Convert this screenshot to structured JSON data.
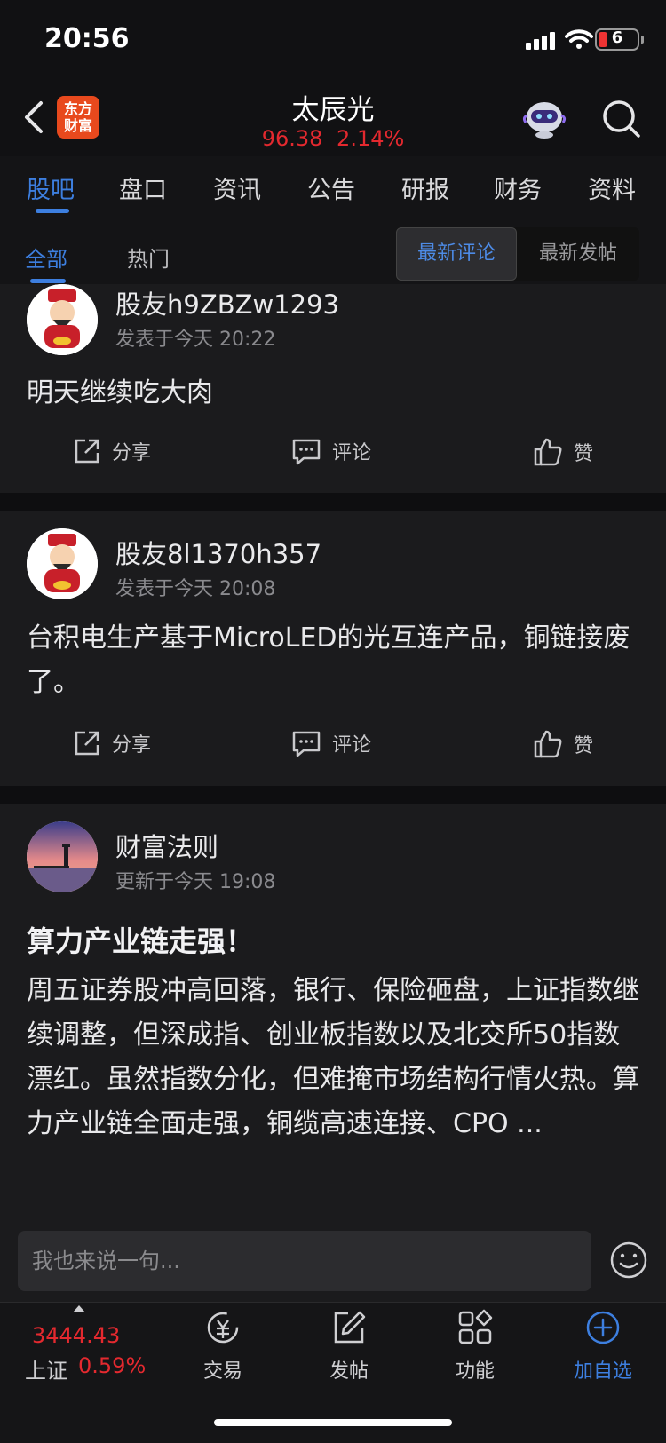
{
  "status": {
    "time": "20:56",
    "battery": "6"
  },
  "header": {
    "logo_line1": "东方",
    "logo_line2": "财富",
    "title": "太辰光",
    "price": "96.38",
    "change": "2.14%"
  },
  "tabs": [
    "股吧",
    "盘口",
    "资讯",
    "公告",
    "研报",
    "财务",
    "资料"
  ],
  "filter": {
    "all": "全部",
    "hot": "热门",
    "latest_comment": "最新评论",
    "latest_post": "最新发帖"
  },
  "actions": {
    "share": "分享",
    "comment": "评论",
    "like": "赞"
  },
  "posts": [
    {
      "user": "股友h9ZBZw1293",
      "time": "发表于今天 20:22",
      "text": "明天继续吃大肉"
    },
    {
      "user": "股友8l1370h357",
      "time": "发表于今天 20:08",
      "text": "台积电生产基于MicroLED的光互连产品，铜链接废了。"
    },
    {
      "user": "财富法则",
      "time": "更新于今天 19:08",
      "title": "算力产业链走强！",
      "text": "周五证券股冲高回落，银行、保险砸盘，上证指数继续调整，但深成指、创业板指数以及北交所50指数漂红。虽然指数分化，但难掩市场结构行情火热。算力产业链全面走强，铜缆高速连接、CPO ..."
    }
  ],
  "input": {
    "placeholder": "我也来说一句..."
  },
  "bottom": {
    "index_value": "3444.43",
    "index_name": "上证",
    "index_change": "0.59%",
    "nav": [
      "交易",
      "发帖",
      "功能",
      "加自选"
    ]
  },
  "colors": {
    "accent": "#3d7fe0",
    "up": "#e4292f",
    "bg": "#1b1b1d"
  }
}
